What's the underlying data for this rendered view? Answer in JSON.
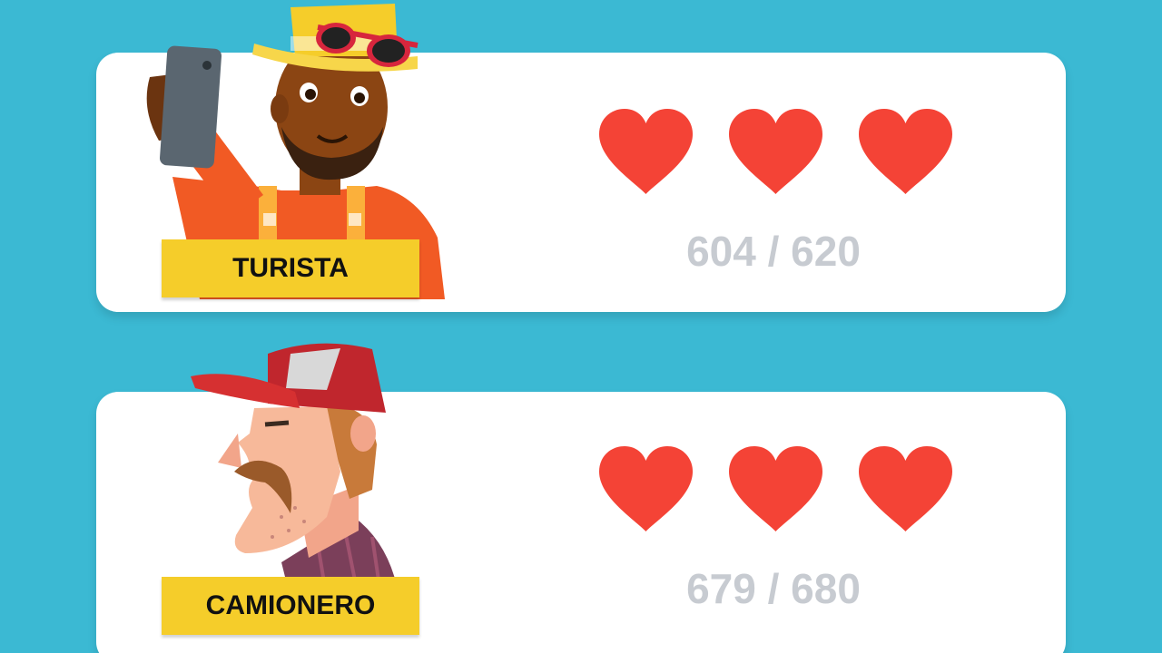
{
  "theme": {
    "background": "#3bb9d3",
    "card": "#ffffff",
    "heart": "#f44336",
    "nameplate": "#f5cd2a",
    "score_text": "#c7cbd1"
  },
  "characters": [
    {
      "name": "TURISTA",
      "avatar_icon": "tourist-avatar",
      "hearts_filled": 3,
      "hearts_total": 3,
      "score": "604 / 620"
    },
    {
      "name": "CAMIONERO",
      "avatar_icon": "trucker-avatar",
      "hearts_filled": 3,
      "hearts_total": 3,
      "score": "679 / 680"
    }
  ]
}
